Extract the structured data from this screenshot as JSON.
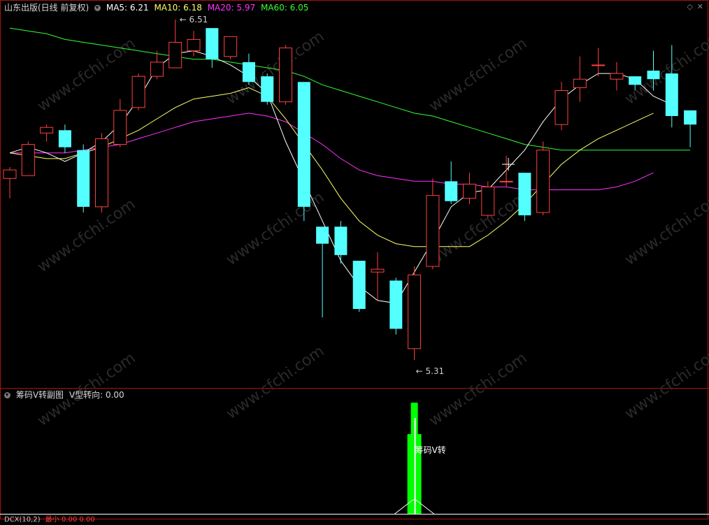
{
  "header": {
    "title": "山东出版(日线 前复权)",
    "ma5": "MA5: 6.21",
    "ma10": "MA10: 6.18",
    "ma20": "MA20: 5.97",
    "ma60": "MA60: 6.05",
    "colors": {
      "title": "#d8d8d8",
      "ma5": "#ffffff",
      "ma10": "#ffff66",
      "ma20": "#ff33ff",
      "ma60": "#33ff33"
    }
  },
  "sub": {
    "title": "筹码V转副图",
    "indicator": "V型转向: 0.00",
    "signal_label": "筹码V转",
    "bottom_label": "DCX(10,2)",
    "bottom_values": "最小 0.00 0.00"
  },
  "watermark": "www.cfchi.com",
  "chart_data": {
    "type": "candlestick",
    "price_high_label": "6.51",
    "price_low_label": "5.31",
    "colors": {
      "up": "#ff4040",
      "down": "#54ffff",
      "border": "#aa1111",
      "ma5": "#ffffff",
      "ma10": "#ffff66",
      "ma20": "#ff33ff",
      "ma60": "#33ff33",
      "signal": "#00ff00"
    },
    "candles": [
      {
        "o": 5.95,
        "h": 5.99,
        "l": 5.88,
        "c": 5.98
      },
      {
        "o": 5.96,
        "h": 6.08,
        "l": 5.96,
        "c": 6.07
      },
      {
        "o": 6.11,
        "h": 6.14,
        "l": 6.08,
        "c": 6.13
      },
      {
        "o": 6.12,
        "h": 6.14,
        "l": 6.04,
        "c": 6.06
      },
      {
        "o": 6.05,
        "h": 6.07,
        "l": 5.83,
        "c": 5.85
      },
      {
        "o": 5.85,
        "h": 6.11,
        "l": 5.83,
        "c": 6.09
      },
      {
        "o": 6.07,
        "h": 6.23,
        "l": 6.06,
        "c": 6.19
      },
      {
        "o": 6.2,
        "h": 6.32,
        "l": 6.19,
        "c": 6.31
      },
      {
        "o": 6.31,
        "h": 6.4,
        "l": 6.3,
        "c": 6.36
      },
      {
        "o": 6.34,
        "h": 6.51,
        "l": 6.34,
        "c": 6.43
      },
      {
        "o": 6.4,
        "h": 6.47,
        "l": 6.38,
        "c": 6.44
      },
      {
        "o": 6.48,
        "h": 6.48,
        "l": 6.34,
        "c": 6.37
      },
      {
        "o": 6.38,
        "h": 6.45,
        "l": 6.37,
        "c": 6.45
      },
      {
        "o": 6.36,
        "h": 6.39,
        "l": 6.28,
        "c": 6.29
      },
      {
        "o": 6.31,
        "h": 6.32,
        "l": 6.21,
        "c": 6.22
      },
      {
        "o": 6.22,
        "h": 6.42,
        "l": 6.21,
        "c": 6.41
      },
      {
        "o": 6.29,
        "h": 6.29,
        "l": 5.8,
        "c": 5.85
      },
      {
        "o": 5.78,
        "h": 5.74,
        "l": 5.46,
        "c": 5.72
      },
      {
        "o": 5.78,
        "h": 5.8,
        "l": 5.65,
        "c": 5.68
      },
      {
        "o": 5.66,
        "h": 5.64,
        "l": 5.48,
        "c": 5.49
      },
      {
        "o": 5.62,
        "h": 5.69,
        "l": 5.52,
        "c": 5.63
      },
      {
        "o": 5.59,
        "h": 5.6,
        "l": 5.4,
        "c": 5.42
      },
      {
        "o": 5.35,
        "h": 5.64,
        "l": 5.31,
        "c": 5.61
      },
      {
        "o": 5.64,
        "h": 5.95,
        "l": 5.63,
        "c": 5.89
      },
      {
        "o": 5.94,
        "h": 6.01,
        "l": 5.86,
        "c": 5.87
      },
      {
        "o": 5.88,
        "h": 5.97,
        "l": 5.86,
        "c": 5.93
      },
      {
        "o": 5.82,
        "h": 5.94,
        "l": 5.81,
        "c": 5.92
      },
      {
        "o": 5.94,
        "h": 6.03,
        "l": 5.92,
        "c": 5.94
      },
      {
        "o": 5.97,
        "h": 5.97,
        "l": 5.8,
        "c": 5.82
      },
      {
        "o": 5.83,
        "h": 6.08,
        "l": 5.82,
        "c": 6.05
      },
      {
        "o": 6.14,
        "h": 6.29,
        "l": 6.12,
        "c": 6.26
      },
      {
        "o": 6.27,
        "h": 6.38,
        "l": 6.22,
        "c": 6.3
      },
      {
        "o": 6.35,
        "h": 6.41,
        "l": 6.31,
        "c": 6.35
      },
      {
        "o": 6.3,
        "h": 6.36,
        "l": 6.26,
        "c": 6.32
      },
      {
        "o": 6.31,
        "h": 6.31,
        "l": 6.26,
        "c": 6.28
      },
      {
        "o": 6.33,
        "h": 6.4,
        "l": 6.26,
        "c": 6.3
      },
      {
        "o": 6.32,
        "h": 6.42,
        "l": 6.13,
        "c": 6.17
      },
      {
        "o": 6.19,
        "h": 6.19,
        "l": 6.06,
        "c": 6.14
      }
    ],
    "ma5": [
      6.04,
      6.06,
      6.04,
      6.01,
      6.04,
      6.08,
      6.14,
      6.23,
      6.34,
      6.39,
      6.4,
      6.38,
      6.35,
      6.31,
      6.25,
      6.08,
      5.94,
      5.8,
      5.66,
      5.57,
      5.52,
      5.51,
      5.62,
      5.73,
      5.85,
      5.9,
      5.91,
      5.98,
      6.05,
      6.15,
      6.23,
      6.28,
      6.32,
      6.32,
      6.3,
      6.24,
      6.21
    ],
    "ma10": [
      6.04,
      6.03,
      6.02,
      6.02,
      6.04,
      6.06,
      6.09,
      6.12,
      6.16,
      6.2,
      6.23,
      6.24,
      6.25,
      6.27,
      6.24,
      6.16,
      6.07,
      5.98,
      5.88,
      5.8,
      5.75,
      5.72,
      5.71,
      5.71,
      5.71,
      5.71,
      5.75,
      5.8,
      5.86,
      5.93,
      6.0,
      6.05,
      6.09,
      6.12,
      6.15,
      6.18
    ],
    "ma20": [
      6.04,
      6.04,
      6.04,
      6.04,
      6.05,
      6.06,
      6.07,
      6.09,
      6.11,
      6.13,
      6.15,
      6.16,
      6.17,
      6.18,
      6.17,
      6.15,
      6.11,
      6.07,
      6.02,
      5.98,
      5.96,
      5.95,
      5.94,
      5.94,
      5.93,
      5.93,
      5.92,
      5.92,
      5.91,
      5.91,
      5.91,
      5.91,
      5.91,
      5.92,
      5.94,
      5.97
    ],
    "ma60": [
      6.48,
      6.47,
      6.46,
      6.44,
      6.43,
      6.42,
      6.41,
      6.4,
      6.39,
      6.38,
      6.37,
      6.37,
      6.36,
      6.35,
      6.34,
      6.33,
      6.31,
      6.28,
      6.26,
      6.24,
      6.22,
      6.2,
      6.18,
      6.17,
      6.15,
      6.13,
      6.11,
      6.09,
      6.07,
      6.06,
      6.05,
      6.05,
      6.05,
      6.05,
      6.05,
      6.05,
      6.05,
      6.05
    ],
    "signal": {
      "index": 22,
      "value": 1.0
    }
  }
}
